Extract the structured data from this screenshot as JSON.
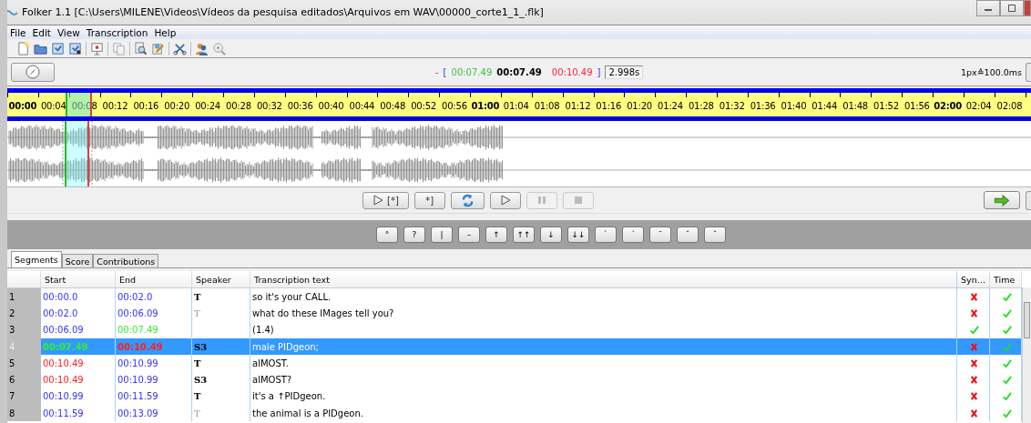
{
  "window": {
    "title": "Folker 1.1 [C:\\Users\\MILENE\\Videos\\Vídeos da pesquisa editados\\Arquivos em WAV\\00000_corte1_1_.flk]"
  },
  "menu": [
    "File",
    "Edit",
    "View",
    "Transcription",
    "Help"
  ],
  "selection_display": {
    "minus": "-",
    "open_bracket": "[",
    "start": "00:07.49",
    "position": "00:07.49",
    "end": "00:10.49",
    "close_bracket": "]",
    "length": "2.998s"
  },
  "zoom_scale": "1px≙100.0ms",
  "ruler": [
    {
      "label": "00:00",
      "major": true
    },
    {
      "label": "00:04",
      "major": false
    },
    {
      "label": "00:08",
      "major": false
    },
    {
      "label": "00:12",
      "major": false
    },
    {
      "label": "00:16",
      "major": false
    },
    {
      "label": "00:20",
      "major": false
    },
    {
      "label": "00:24",
      "major": false
    },
    {
      "label": "00:28",
      "major": false
    },
    {
      "label": "00:32",
      "major": false
    },
    {
      "label": "00:36",
      "major": false
    },
    {
      "label": "00:40",
      "major": false
    },
    {
      "label": "00:44",
      "major": false
    },
    {
      "label": "00:48",
      "major": false
    },
    {
      "label": "00:52",
      "major": false
    },
    {
      "label": "00:56",
      "major": false
    },
    {
      "label": "01:00",
      "major": true
    },
    {
      "label": "01:04",
      "major": false
    },
    {
      "label": "01:08",
      "major": false
    },
    {
      "label": "01:12",
      "major": false
    },
    {
      "label": "01:16",
      "major": false
    },
    {
      "label": "01:20",
      "major": false
    },
    {
      "label": "01:24",
      "major": false
    },
    {
      "label": "01:28",
      "major": false
    },
    {
      "label": "01:32",
      "major": false
    },
    {
      "label": "01:36",
      "major": false
    },
    {
      "label": "01:40",
      "major": false
    },
    {
      "label": "01:44",
      "major": false
    },
    {
      "label": "01:48",
      "major": false
    },
    {
      "label": "01:52",
      "major": false
    },
    {
      "label": "01:56",
      "major": false
    },
    {
      "label": "02:00",
      "major": true
    },
    {
      "label": "02:04",
      "major": false
    },
    {
      "label": "02:08",
      "major": false
    }
  ],
  "playback_buttons": [
    {
      "kind": "play",
      "label": "[*]",
      "disabled": false
    },
    {
      "kind": "text",
      "label": "*]",
      "disabled": false
    },
    {
      "kind": "loop",
      "disabled": false
    },
    {
      "kind": "play",
      "disabled": false
    },
    {
      "kind": "pause",
      "disabled": true
    },
    {
      "kind": "stop",
      "disabled": true
    }
  ],
  "symbols": [
    "°",
    "?",
    "|",
    "–",
    "↑",
    "↑↑",
    "↓",
    "↓↓",
    "`",
    "´",
    "¯",
    "ˆ",
    "ˇ"
  ],
  "tabs": [
    {
      "label": "Segments",
      "selected": true
    },
    {
      "label": "Score",
      "selected": false
    },
    {
      "label": "Contributions",
      "selected": false
    }
  ],
  "table": {
    "columns": [
      "Start",
      "End",
      "Speaker",
      "Transcription text",
      "Syn…",
      "Time"
    ],
    "rows": [
      {
        "number": "1",
        "start": {
          "text": "00:00.0",
          "color": "#3333ff"
        },
        "end": {
          "text": "00:02.0",
          "color": "#3333ff"
        },
        "speaker": "T",
        "speaker_bold": true,
        "text": "so it's your CALL.",
        "sync": false,
        "time": true,
        "selected": false
      },
      {
        "number": "2",
        "start": {
          "text": "00:02.0",
          "color": "#3333ff"
        },
        "end": {
          "text": "00:06.09",
          "color": "#3333ff"
        },
        "speaker": "T",
        "speaker_bold": false,
        "text": "what do these IMages tell you?",
        "sync": false,
        "time": true,
        "selected": false
      },
      {
        "number": "3",
        "start": {
          "text": "00:06.09",
          "color": "#3333ff"
        },
        "end": {
          "text": "00:07.49",
          "color": "#33ee33"
        },
        "text": "(1.4)",
        "sync": true,
        "time": true,
        "selected": false
      },
      {
        "number": "4",
        "start": {
          "text": "00:07.49",
          "color": "#33ee33"
        },
        "end": {
          "text": "00:10.49",
          "color": "#ff2020"
        },
        "speaker": "S3",
        "speaker_bold": true,
        "text": "male PIDgeon;",
        "sync": false,
        "time": true,
        "selected": true
      },
      {
        "number": "5",
        "start": {
          "text": "00:10.49",
          "color": "#ff2020"
        },
        "end": {
          "text": "00:10.99",
          "color": "#3333ff"
        },
        "speaker": "T",
        "speaker_bold": true,
        "text": "alMOST.",
        "sync": false,
        "time": true,
        "selected": false
      },
      {
        "number": "6",
        "start": {
          "text": "00:10.49",
          "color": "#ff2020"
        },
        "end": {
          "text": "00:10.99",
          "color": "#3333ff"
        },
        "speaker": "S3",
        "speaker_bold": true,
        "text": "alMOST?",
        "sync": false,
        "time": true,
        "selected": false
      },
      {
        "number": "7",
        "start": {
          "text": "00:10.99",
          "color": "#3333ff"
        },
        "end": {
          "text": "00:11.59",
          "color": "#3333ff"
        },
        "speaker": "T",
        "speaker_bold": true,
        "text": "it's a ↑PIDgeon.",
        "sync": false,
        "time": true,
        "selected": false
      },
      {
        "number": "8",
        "start": {
          "text": "00:11.59",
          "color": "#3333ff"
        },
        "end": {
          "text": "00:13.09",
          "color": "#3333ff"
        },
        "speaker": "T",
        "speaker_bold": false,
        "text": "the animal is a PIDgeon.",
        "sync": false,
        "time": true,
        "selected": false
      }
    ]
  }
}
